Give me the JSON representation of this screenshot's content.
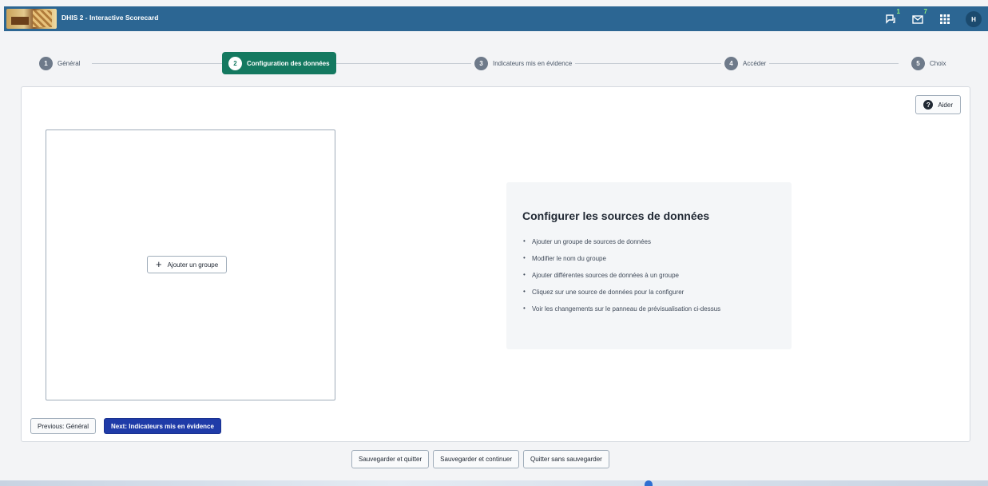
{
  "header": {
    "app_title": "DHIS 2 - Interactive Scorecard",
    "interpretations_badge": "1",
    "messages_badge": "7",
    "avatar_initial": "H"
  },
  "stepper": {
    "steps": [
      {
        "num": "1",
        "label": "Général"
      },
      {
        "num": "2",
        "label": "Configuration des données"
      },
      {
        "num": "3",
        "label": "Indicateurs mis en évidence"
      },
      {
        "num": "4",
        "label": "Accéder"
      },
      {
        "num": "5",
        "label": "Choix"
      }
    ],
    "active_step": 2
  },
  "main": {
    "help_button": "Aider",
    "add_group_button": "Ajouter un groupe",
    "help_panel": {
      "title": "Configurer les sources de données",
      "items": [
        "Ajouter un groupe de sources de données",
        "Modifier le nom du groupe",
        "Ajouter différentes sources de données à un groupe",
        "Cliquez sur une source de données pour la configurer",
        "Voir les changements sur le panneau de prévisualisation ci-dessus"
      ]
    },
    "previous_button": "Previous: Général",
    "next_button": "Next: Indicateurs mis en évidence"
  },
  "footer": {
    "save_quit": "Sauvegarder et quitter",
    "save_continue": "Sauvegarder et continuer",
    "quit_no_save": "Quitter sans sauvegarder"
  },
  "colors": {
    "header_bg": "#2c6693",
    "active_step": "#147960",
    "primary_button": "#1f3ba8"
  }
}
